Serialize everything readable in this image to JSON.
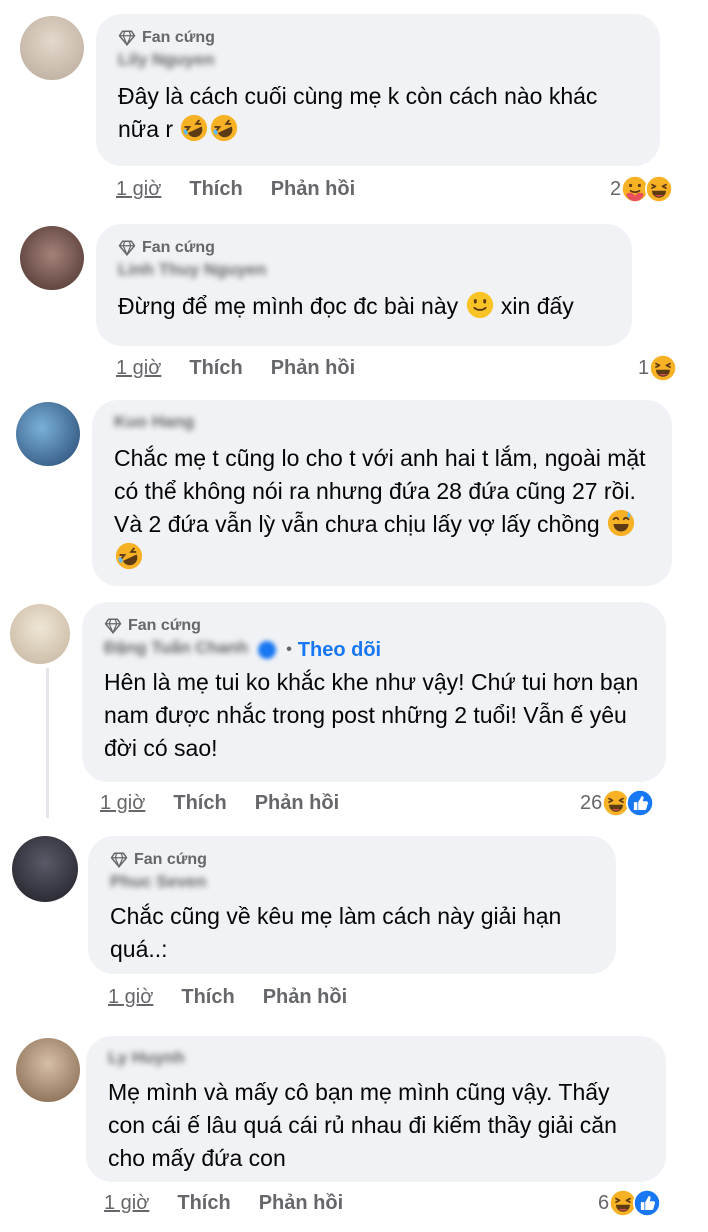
{
  "comments": [
    {
      "badge": "Fan cứng",
      "name": "Lily Nguyen",
      "text": "Đây là cách cuối cùng mẹ k còn cách nào khác nữa r",
      "time": "1 giờ",
      "like": "Thích",
      "reply": "Phản hồi",
      "react_count": "2",
      "avatar_color": "#cfc2b6"
    },
    {
      "badge": "Fan cứng",
      "name": "Linh Thuy Nguyen",
      "text": "Đừng để mẹ mình đọc đc bài này",
      "text_after": "xin đấy",
      "time": "1 giờ",
      "like": "Thích",
      "reply": "Phản hồi",
      "react_count": "1",
      "avatar_color": "#6e4f4a"
    },
    {
      "name": "Kuo Hang",
      "text": "Chắc mẹ t cũng lo cho t với anh hai t lắm, ngoài mặt có thể không nói ra nhưng đứa 28 đứa cũng 27 rồi.  Và 2 đứa vẫn lỳ vẫn chưa chịu lấy vợ lấy chồng",
      "avatar_color": "#3a5f8a"
    },
    {
      "badge": "Fan cứng",
      "name": "Đặng Tuấn Chanh",
      "follow": "Theo dõi",
      "text": "Hên là mẹ tui ko khắc khe như vậy! Chứ tui hơn bạn nam được nhắc trong post những 2 tuổi! Vẫn ế yêu đời có sao!",
      "time": "1 giờ",
      "like": "Thích",
      "reply": "Phản hồi",
      "react_count": "26",
      "avatar_color": "#d8cfbf"
    },
    {
      "badge": "Fan cứng",
      "name": "Phuc Seven",
      "text": "Chắc cũng về kêu mẹ làm cách này giải hạn quá..:",
      "time": "1 giờ",
      "like": "Thích",
      "reply": "Phản hồi",
      "avatar_color": "#3b3b46"
    },
    {
      "name": "Ly Huynh",
      "text": "Mẹ mình và mấy cô bạn mẹ mình cũng vậy. Thấy con cái ế lâu quá cái rủ nhau đi kiếm thầy giải căn cho mấy đứa con",
      "time": "1 giờ",
      "like": "Thích",
      "reply": "Phản hồi",
      "react_count": "6",
      "avatar_color": "#b59a80"
    }
  ],
  "colors": {
    "bubble": "#f0f2f5",
    "secondary_text": "#65676b",
    "link_blue": "#1877f2",
    "emoji_yellow": "#f7b125"
  },
  "icons": [
    "diamond-icon",
    "rofl-emoji",
    "slight-smile-emoji",
    "sweat-smile-emoji",
    "haha-reaction-icon",
    "like-reaction-icon",
    "care-reaction-icon",
    "verified-badge-icon"
  ]
}
